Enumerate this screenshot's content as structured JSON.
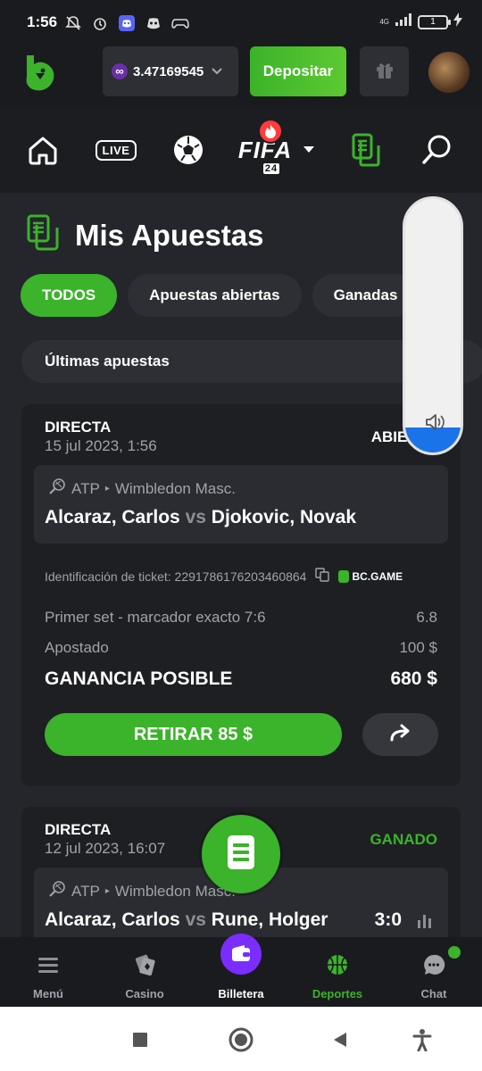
{
  "status_bar": {
    "time": "1:56",
    "network": "4G",
    "battery": "1"
  },
  "header": {
    "balance": "3.47169545",
    "deposit_label": "Depositar",
    "icons": [
      "logo-icon",
      "currency-icon",
      "chevron-down-icon",
      "gift-icon",
      "avatar"
    ]
  },
  "nav": {
    "live_label": "LIVE",
    "fifa_label": "FIFA",
    "fifa_year": "24",
    "icons": [
      "home-icon",
      "soccer-ball-icon",
      "bets-icon",
      "search-icon"
    ]
  },
  "page": {
    "title": "Mis Apuestas"
  },
  "tabs": [
    {
      "label": "TODOS",
      "active": true
    },
    {
      "label": "Apuestas abiertas",
      "active": false
    },
    {
      "label": "Ganadas",
      "active": false
    }
  ],
  "latest_label": "Últimas apuestas",
  "volume": {
    "level": 0.1
  },
  "bets": [
    {
      "type": "DIRECTA",
      "date": "15 jul 2023, 1:56",
      "status": "ABIERTA",
      "league": "ATP",
      "tournament": "Wimbledon Masc.",
      "home": "Alcaraz, Carlos",
      "vs": "vs",
      "away": "Djokovic, Novak",
      "ticket_label": "Identificación de ticket:",
      "ticket_id": "2291786176203460864",
      "brand": "BC.GAME",
      "market": "Primer set - marcador exacto 7:6",
      "odds": "6.8",
      "stake_label": "Apostado",
      "stake": "100 $",
      "payout_label": "GANANCIA POSIBLE",
      "payout": "680 $",
      "cashout_label": "RETIRAR 85 $"
    },
    {
      "type": "DIRECTA",
      "date": "12 jul 2023, 16:07",
      "status": "GANADO",
      "league": "ATP",
      "tournament": "Wimbledon Masc.",
      "home": "Alcaraz, Carlos",
      "vs": "vs",
      "away": "Rune, Holger",
      "score": "3:0"
    }
  ],
  "bottom_nav": [
    {
      "label": "Menú",
      "icon": "menu-icon"
    },
    {
      "label": "Casino",
      "icon": "casino-icon"
    },
    {
      "label": "Billetera",
      "icon": "wallet-icon"
    },
    {
      "label": "Deportes",
      "icon": "basketball-icon"
    },
    {
      "label": "Chat",
      "icon": "chat-icon"
    }
  ],
  "colors": {
    "accent": "#3bb32a",
    "background": "#24262b",
    "card": "#1e1f23",
    "wallet": "#7b2cff"
  }
}
